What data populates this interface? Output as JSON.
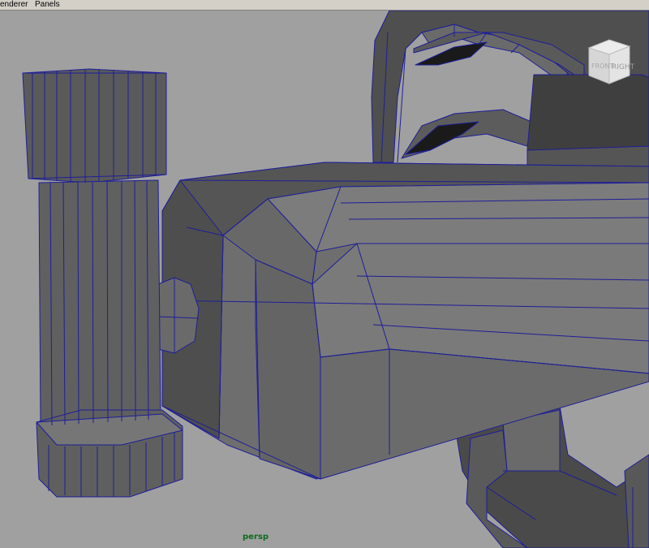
{
  "menubar": {
    "items": [
      "enderer",
      "Panels"
    ]
  },
  "viewport": {
    "camera_label": "persp",
    "viewcube": {
      "front_label": "FRONT",
      "right_label": "RIGHT"
    },
    "wireframe_color": "#1e1e9a",
    "background_color": "#a0a0a0",
    "label_color": "#0f6b1e"
  }
}
